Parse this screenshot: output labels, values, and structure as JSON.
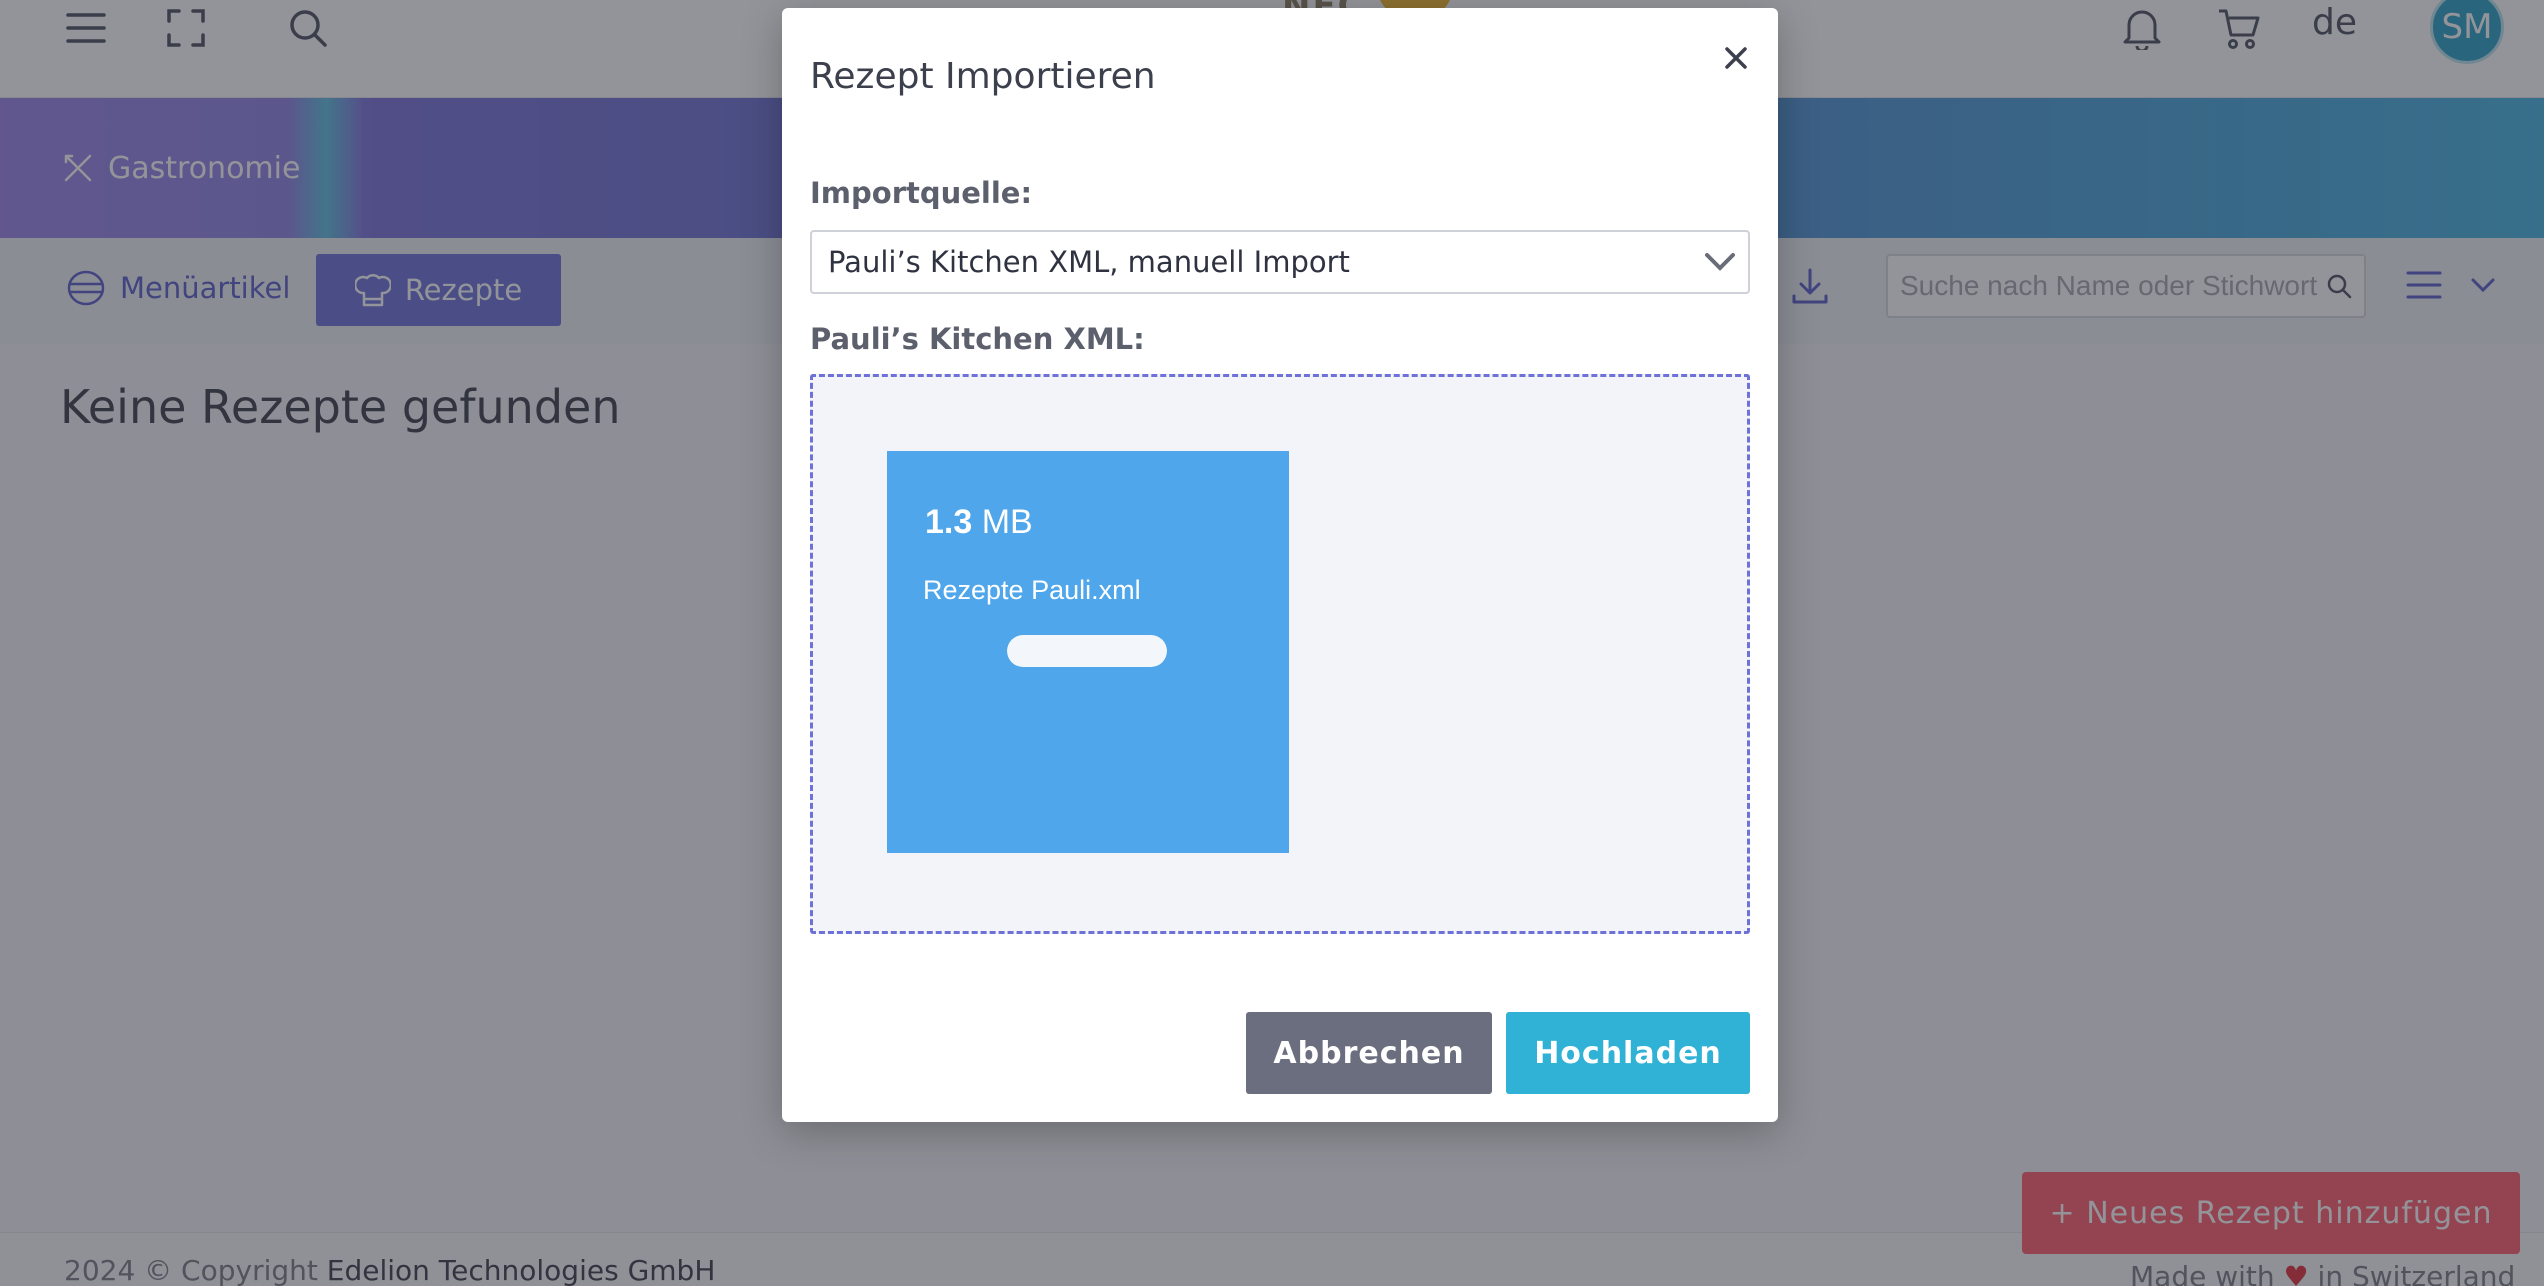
{
  "topbar": {
    "logo_text": "NEC",
    "language": "de",
    "user_initials": "SM"
  },
  "banner": {
    "section_label": "Gastronomie"
  },
  "subnav": {
    "menu_items_label": "Menüartikel",
    "recipes_label": "Rezepte",
    "search_placeholder": "Suche nach Name oder Stichwort"
  },
  "main": {
    "empty_message": "Keine Rezepte gefunden",
    "add_button_label": "+ Neues Rezept hinzufügen"
  },
  "footer": {
    "copyright_prefix": "2024 © Copyright",
    "company": "Edelion Technologies GmbH",
    "made_with_prefix": "Made with",
    "made_with_suffix": "in Switzerland"
  },
  "modal": {
    "title": "Rezept Importieren",
    "source_label": "Importquelle:",
    "source_value": "Pauli’s Kitchen XML, manuell Import",
    "file_label": "Pauli’s Kitchen XML:",
    "file": {
      "size_value": "1.3",
      "size_unit": "MB",
      "name": "Rezepte Pauli.xml",
      "upload_progress": 1.0
    },
    "cancel_label": "Abbrechen",
    "upload_label": "Hochladen"
  },
  "colors": {
    "accent": "#6d71d8",
    "primary_button": "#2fb2d6",
    "secondary_button": "#6b6e7e",
    "add_button": "#ff5e6d",
    "file_card": "#4fa6ea"
  }
}
